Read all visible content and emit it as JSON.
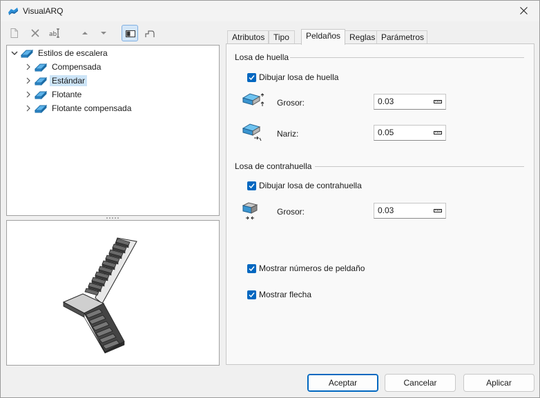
{
  "window": {
    "title": "VisualARQ"
  },
  "toolbar": {
    "buttons": [
      "new-document-icon",
      "delete-icon",
      "rename-icon",
      "move-up-icon",
      "move-down-icon",
      "preview-toggle-icon",
      "stair-profile-icon"
    ]
  },
  "tree": {
    "root": "Estilos de escalera",
    "items": [
      {
        "label": "Compensada",
        "selected": false
      },
      {
        "label": "Estándar",
        "selected": true
      },
      {
        "label": "Flotante",
        "selected": false
      },
      {
        "label": "Flotante compensada",
        "selected": false
      }
    ]
  },
  "tabs": [
    {
      "label": "Atributos",
      "active": false
    },
    {
      "label": "Tipo",
      "active": false
    },
    {
      "label": "Peldaños",
      "active": true
    },
    {
      "label": "Reglas",
      "active": false
    },
    {
      "label": "Parámetros",
      "active": false
    }
  ],
  "panel": {
    "tread": {
      "title": "Losa de huella",
      "checkbox": "Dibujar losa de huella",
      "checked": true,
      "thickness_label": "Grosor:",
      "thickness_value": "0.03",
      "nosing_label": "Nariz:",
      "nosing_value": "0.05"
    },
    "riser": {
      "title": "Losa de contrahuella",
      "checkbox": "Dibujar losa de contrahuella",
      "checked": true,
      "thickness_label": "Grosor:",
      "thickness_value": "0.03"
    },
    "show_numbers": {
      "label": "Mostrar números de peldaño",
      "checked": true
    },
    "show_arrow": {
      "label": "Mostrar flecha",
      "checked": true
    }
  },
  "buttons": {
    "accept": "Aceptar",
    "cancel": "Cancelar",
    "apply": "Aplicar"
  },
  "colors": {
    "accent": "#0067c0",
    "selection": "#cce4f7"
  }
}
